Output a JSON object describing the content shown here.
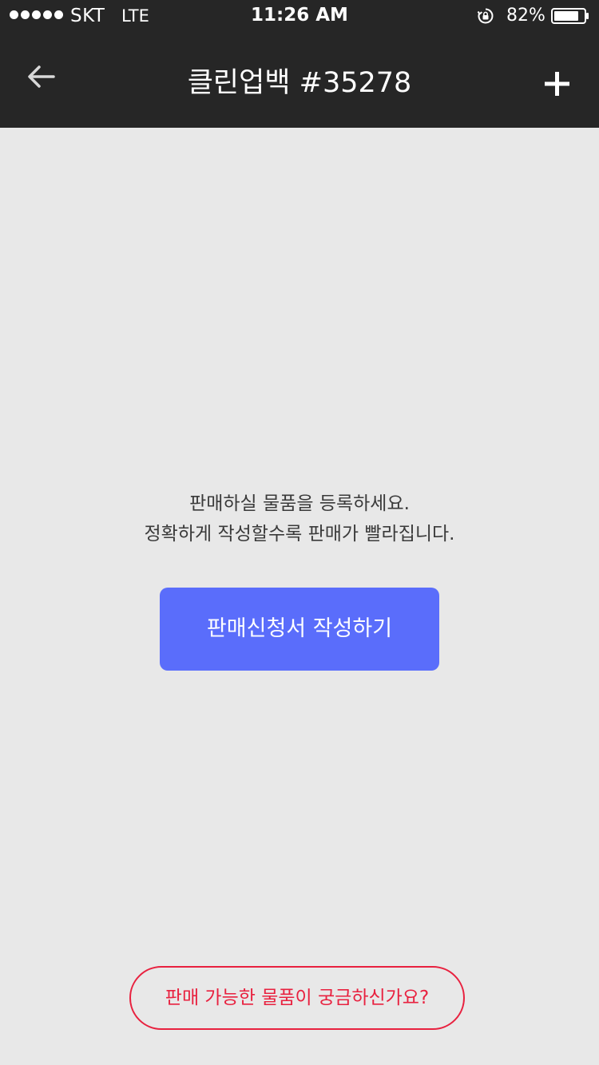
{
  "status_bar": {
    "carrier": "SKT",
    "network": "LTE",
    "time": "11:26 AM",
    "battery": "82%",
    "signal_bars": 5,
    "battery_level": 0.82
  },
  "nav": {
    "title": "클린업백 #35278",
    "back_icon": "arrow-left-icon",
    "add_icon": "plus-icon"
  },
  "main": {
    "guide_line1": "판매하실 물품을 등록하세요.",
    "guide_line2": "정확하게 작성할수록 판매가 빨라집니다.",
    "apply_button": "판매신청서 작성하기",
    "faq_button": "판매 가능한 물품이 궁금하신가요?"
  },
  "colors": {
    "nav_background": "#262626",
    "page_background": "#e8e8e8",
    "primary_button": "#5a6dfb",
    "accent_red": "#e8213f"
  }
}
